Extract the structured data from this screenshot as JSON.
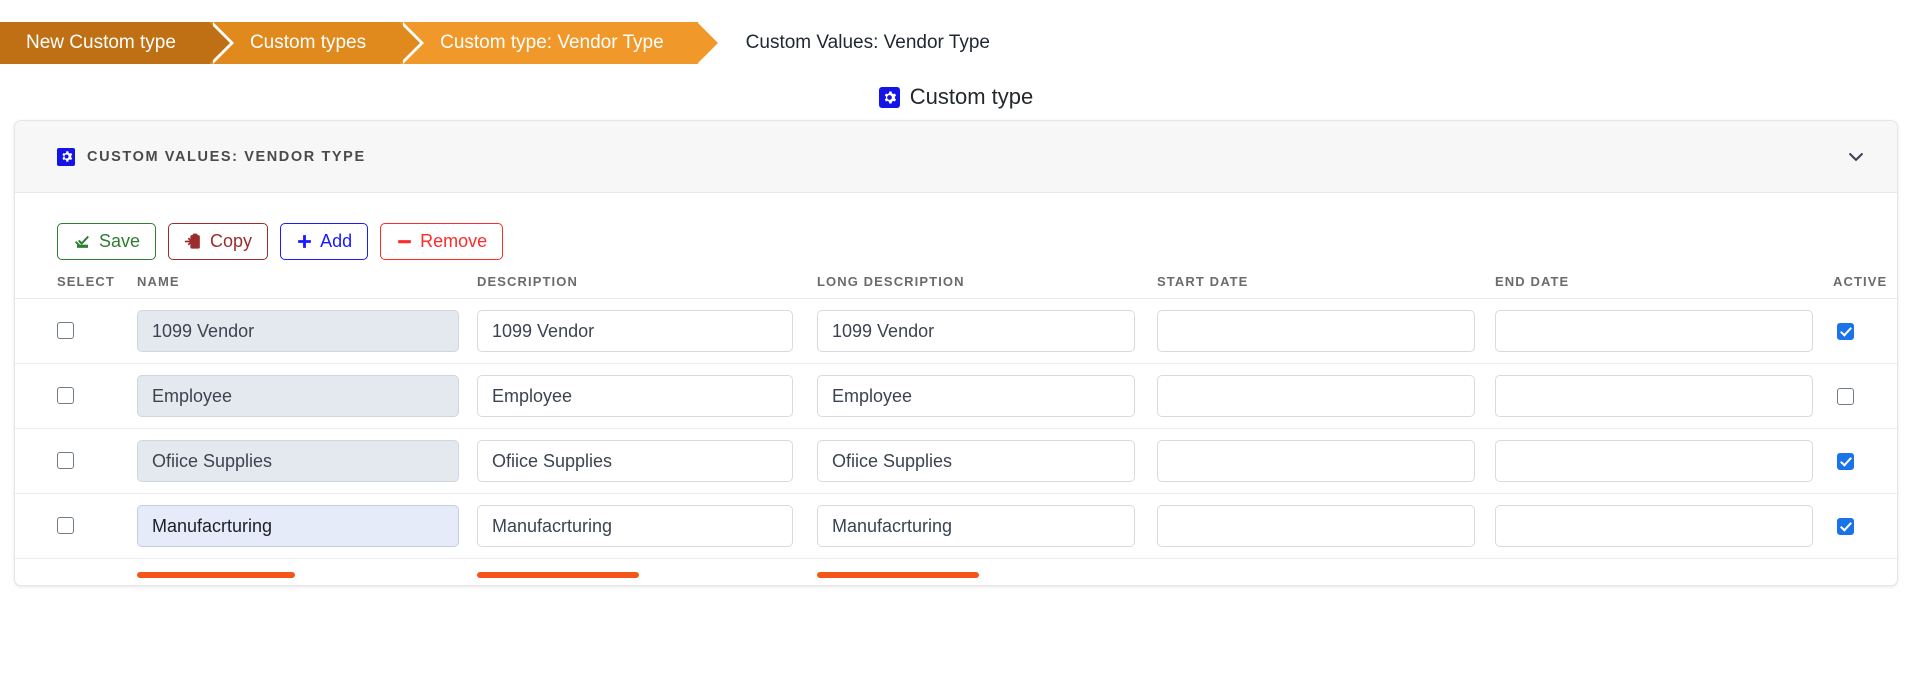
{
  "breadcrumb": {
    "items": [
      {
        "label": "New Custom type",
        "style": "dark-orange"
      },
      {
        "label": "Custom types",
        "style": "mid-orange"
      },
      {
        "label": "Custom type: Vendor Type",
        "style": "light-orange"
      }
    ],
    "current": "Custom Values: Vendor Type"
  },
  "page": {
    "title": "Custom type",
    "icon": "gear-icon"
  },
  "panel": {
    "title": "Custom Values: Vendor Type",
    "icon": "gear-icon",
    "collapse_icon": "chevron-down-icon"
  },
  "toolbar": {
    "buttons": [
      {
        "label": "Save",
        "icon": "save-icon",
        "color": "#2e7d32"
      },
      {
        "label": "Copy",
        "icon": "copy-icon",
        "color": "#9b2d2d"
      },
      {
        "label": "Add",
        "icon": "plus-icon",
        "color": "#1a1aff"
      },
      {
        "label": "Remove",
        "icon": "minus-icon",
        "color": "#ff2a2a"
      }
    ]
  },
  "table": {
    "columns": [
      {
        "key": "select",
        "label": "Select"
      },
      {
        "key": "name",
        "label": "Name"
      },
      {
        "key": "description",
        "label": "Description"
      },
      {
        "key": "long_description",
        "label": "Long Description"
      },
      {
        "key": "start_date",
        "label": "Start Date"
      },
      {
        "key": "end_date",
        "label": "End Date"
      },
      {
        "key": "active",
        "label": "Active"
      }
    ],
    "rows": [
      {
        "selected": false,
        "name": "1099 Vendor",
        "name_state": "readonly",
        "description": "1099 Vendor",
        "long_description": "1099 Vendor",
        "start_date": "",
        "end_date": "",
        "active": true
      },
      {
        "selected": false,
        "name": "Employee",
        "name_state": "readonly",
        "description": "Employee",
        "long_description": "Employee",
        "start_date": "",
        "end_date": "",
        "active": false
      },
      {
        "selected": false,
        "name": "Ofiice Supplies",
        "name_state": "readonly",
        "description": "Ofiice Supplies",
        "long_description": "Ofiice Supplies",
        "start_date": "",
        "end_date": "",
        "active": true
      },
      {
        "selected": false,
        "name": "Manufacrturing",
        "name_state": "focused",
        "description": "Manufacrturing",
        "long_description": "Manufacrturing",
        "start_date": "",
        "end_date": "",
        "active": true
      }
    ]
  },
  "markers": {
    "color": "#f4561a",
    "under_columns": [
      "name",
      "description",
      "long_description"
    ]
  }
}
